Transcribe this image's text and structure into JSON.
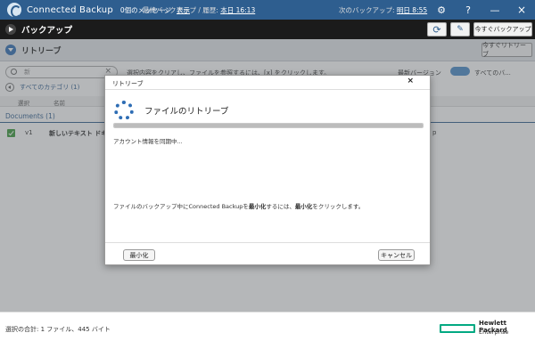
{
  "titlebar": {
    "app_title": "Connected Backup",
    "messages": "0個のメッセージ",
    "show_link": "表示"
  },
  "toolbar": {
    "title": "バックアップ",
    "last_backup_label": "最終バックアップ / 履歴:",
    "last_backup_value": "本日 16:13",
    "next_backup_label": "次のバックアップ:",
    "next_backup_value": "明日 8:55",
    "backup_now": "今すぐバックアップ"
  },
  "retrieve_bar": {
    "title": "リトリーブ",
    "retrieve_now": "今すぐリトリーブ"
  },
  "content": {
    "search_value": "新",
    "hint": "選択内容をクリアし、ファイルを参照するには、[x] をクリックします。",
    "latest_version": "最新バージョン",
    "all_versions": "すべてのバ...",
    "all_categories": "すべてのカテゴリ (1)",
    "col_select": "選択",
    "col_name": "名前",
    "group_label": "Documents (1)",
    "file_row": {
      "version": "v1",
      "name": "新しいテキスト ドキュメ",
      "tail": "p"
    }
  },
  "dialog": {
    "title": "リトリーブ",
    "heading": "ファイルのリトリーブ",
    "sync_msg": "アカウント情報を同期中...",
    "info_pre": "ファイルのバックアップ中にConnected Backupを",
    "info_bold1": "最小化",
    "info_mid": "するには、",
    "info_bold2": "最小化",
    "info_post": "をクリックします。",
    "minimize": "最小化",
    "cancel": "キャンセル",
    "progress_fraction": 1.0
  },
  "statusbar": {
    "selection": "選択の合計: 1 ファイル、445 バイト",
    "brand_name_1": "Hewlett Packard",
    "brand_name_2": "Enterprise"
  },
  "icons": {
    "close": "×",
    "help": "?",
    "refresh": "⟳",
    "settings": "🔧"
  },
  "colors": {
    "titlebar": "#2e5e8f",
    "toolbar": "#1b1b1b",
    "accent": "#2e6db4",
    "check": "#3a9a3a",
    "hpe_green": "#01a982"
  }
}
